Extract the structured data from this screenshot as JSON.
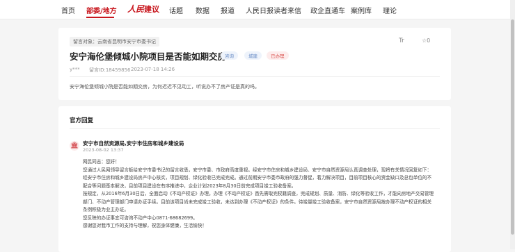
{
  "nav": {
    "items": [
      "首页",
      "部委/地方",
      "话题",
      "数据",
      "报道",
      "人民日报读者来信",
      "政企直通车",
      "案例库",
      "理论"
    ],
    "active_index": 1,
    "logo_text": "人民",
    "logo_suffix": "建议"
  },
  "message": {
    "target_label": "留言对象：云南省昆明市安宁市委书记",
    "font_toggle": "Tr",
    "like_count": "☆0",
    "title": "安宁海伦堡倾城小院项目是否能如期交房",
    "tags": [
      "咨询",
      "城建",
      "已办理"
    ],
    "author": "y***",
    "message_id": "留言ID:18459856",
    "datetime": "2023-07-18 14:26",
    "body": "安宁海伦堡倾城小院是否能如期交房，为何迟迟不见动工，听说办不了房产证是真的吗。"
  },
  "reply": {
    "section_title": "官方回复",
    "department": "安宁市自然资源局,安宁市住房和城乡建设局",
    "date": "2023-08-02 13:37",
    "lines": [
      "网民同志：您好！",
      "您通过人民网领导留言板给安宁市委书记的留言收悉，安宁市委、市政府高度重视。经安宁市住房和城乡建设局、安宁市自然资源局认真调查处理，现将有关情况回复如下：",
      "经安宁市住房和城乡建设局房产中心核实，项目规划、绿化验收已完成完成。通过前期安宁市委市政府的强力督促，着力解决项目，目前项目核心的资金缺口及总包单位的不",
      "配合等问题基本解决，目前项目建设在有序推进中，企业计划2023年8月30日前完成项目竣工验收备案。",
      "按规定，从2016年6月30日后，全面启动《不动产权证》办理。办理《不动产权证》首先需取完权籍调查，完成规划、质量、消防、绿化等验收工作，才能向房地产交易管理",
      "部门、不动产管理部门申请办证手续。目前该项目尚未完成竣工验收，未达到办理《不动产权证》的条件。待竣量竣工验收备案，安宁市自然资源局按办理不动产权证的相关",
      "条例积极为业主办证。",
      "您反映的办证事宜可咨询不动产中心0871-68682699。",
      "感谢您对我市工作的支持与理解，祝您身体健康，生活愉快！"
    ]
  }
}
